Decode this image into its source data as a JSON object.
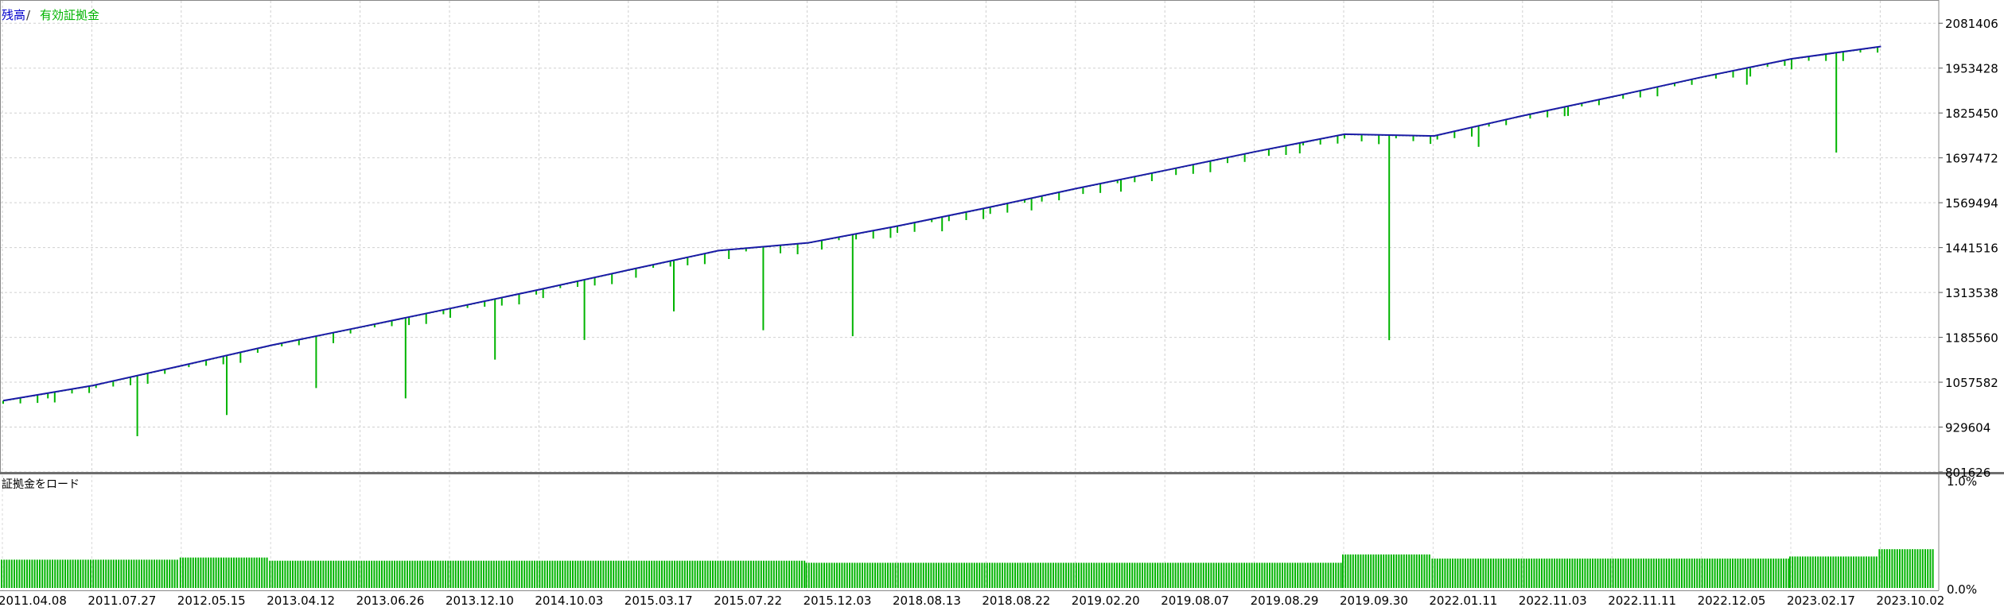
{
  "legend": {
    "balance_label": "残高",
    "separator": " / ",
    "equity_label": "有効証拠金",
    "balance_color": "#0000cc",
    "equity_color": "#00b400"
  },
  "margin_panel": {
    "label": "証拠金をロード",
    "axis_top": "1.0%",
    "axis_bottom": "0.0%",
    "bar_color": "#00b400"
  },
  "chart_data": [
    {
      "type": "line",
      "title": "",
      "series": [
        {
          "name": "残高",
          "color": "#1a1aa6",
          "x": [
            "2011.04.08",
            "2011.07.27",
            "2012.05.15",
            "2013.04.12",
            "2013.06.26",
            "2013.12.10",
            "2014.10.03",
            "2015.03.17",
            "2015.07.22",
            "2015.12.03",
            "2018.08.13",
            "2018.08.22",
            "2019.02.20",
            "2019.08.07",
            "2019.08.29",
            "2019.09.30",
            "2022.01.11",
            "2022.11.03",
            "2022.11.11",
            "2022.12.05",
            "2023.02.17",
            "2023.10.02"
          ],
          "values": [
            1005000,
            1048000,
            1105000,
            1163000,
            1215000,
            1268000,
            1322000,
            1378000,
            1433000,
            1455000,
            1503000,
            1555000,
            1610000,
            1662000,
            1715000,
            1765000,
            1760000,
            1818000,
            1872000,
            1928000,
            1980000,
            2015000
          ]
        },
        {
          "name": "有効証拠金",
          "color": "#00b400",
          "x": [
            "2011.04.08",
            "2011.07.27",
            "2012.05.15",
            "2013.04.12",
            "2013.06.26",
            "2013.12.10",
            "2014.10.03",
            "2015.03.17",
            "2015.07.22",
            "2015.12.03",
            "2018.08.13",
            "2018.08.22",
            "2019.02.20",
            "2019.08.07",
            "2019.08.29",
            "2019.09.30",
            "2022.01.11",
            "2022.11.03",
            "2022.11.11",
            "2022.12.05",
            "2023.02.17",
            "2023.10.02"
          ],
          "values": [
            990000,
            875000,
            935000,
            1015000,
            985000,
            1095000,
            1150000,
            1232000,
            1195000,
            1165000,
            1462000,
            1520000,
            1575000,
            1630000,
            1685000,
            1180000,
            1700000,
            1790000,
            1845000,
            1880000,
            1695000,
            1985000
          ]
        }
      ],
      "x_tick_labels": [
        "2011.04.08",
        "2011.07.27",
        "2012.05.15",
        "2013.04.12",
        "2013.06.26",
        "2013.12.10",
        "2014.10.03",
        "2015.03.17",
        "2015.07.22",
        "2015.12.03",
        "2018.08.13",
        "2018.08.22",
        "2019.02.20",
        "2019.08.07",
        "2019.08.29",
        "2019.09.30",
        "2022.01.11",
        "2022.11.03",
        "2022.11.11",
        "2022.12.05",
        "2023.02.17",
        "2023.10.02"
      ],
      "y_tick_labels": [
        "801626",
        "929604",
        "1057582",
        "1185560",
        "1313538",
        "1441516",
        "1569494",
        "1697472",
        "1825450",
        "1953428",
        "2081406"
      ],
      "ylim": [
        801626,
        2145395
      ],
      "grid": true,
      "legend_position": "top-left"
    },
    {
      "type": "bar",
      "title": "",
      "ylim": [
        0,
        1.0
      ],
      "segments": [
        {
          "from": "2011.04.08",
          "to": "2012.05.15",
          "load_percent": 0.27
        },
        {
          "from": "2012.05.15",
          "to": "2013.04.12",
          "load_percent": 0.29
        },
        {
          "from": "2013.04.12",
          "to": "2015.12.03",
          "load_percent": 0.26
        },
        {
          "from": "2015.12.03",
          "to": "2019.09.30",
          "load_percent": 0.24
        },
        {
          "from": "2019.09.30",
          "to": "2022.01.11",
          "load_percent": 0.32
        },
        {
          "from": "2022.01.11",
          "to": "2023.02.17",
          "load_percent": 0.28
        },
        {
          "from": "2023.02.17",
          "to": "2023.10.02",
          "load_percent": 0.3
        },
        {
          "from": "2023.10.02",
          "to": "2023.10.02",
          "load_percent": 0.37
        }
      ]
    }
  ]
}
